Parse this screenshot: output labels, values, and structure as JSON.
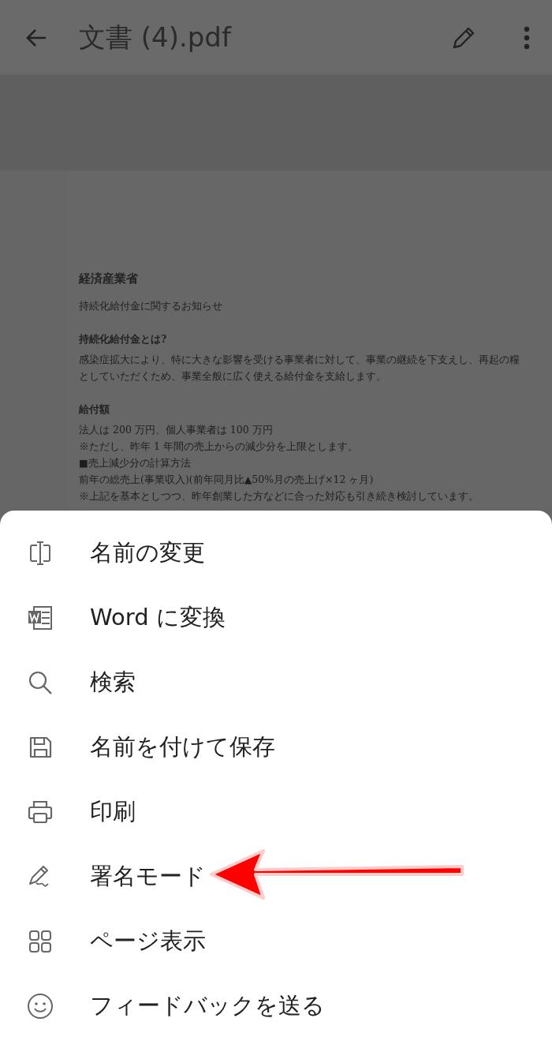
{
  "app_bar": {
    "title": "文書 (4).pdf"
  },
  "document": {
    "lines": [
      {
        "kind": "title",
        "text": "経済産業省"
      },
      {
        "kind": "text",
        "text": "持続化給付金に関するお知らせ"
      },
      {
        "kind": "heading",
        "text": "持続化給付金とは?"
      },
      {
        "kind": "text",
        "text": "感染症拡大により、特に大きな影響を受ける事業者に対して、事業の継続を下支えし、再起の糧"
      },
      {
        "kind": "text",
        "text": "としていただくため、事業全般に広く使える給付金を支給します。"
      },
      {
        "kind": "heading",
        "text": "給付額"
      },
      {
        "kind": "text",
        "text": "法人は 200 万円、個人事業者は 100 万円"
      },
      {
        "kind": "text",
        "text": "※ただし、昨年 1 年間の売上からの減少分を上限とします。"
      },
      {
        "kind": "text",
        "text": "■売上減少分の計算方法"
      },
      {
        "kind": "text",
        "text": "前年の総売上(事業収入)(前年同月比▲50%月の売上げ×12 ヶ月)"
      },
      {
        "kind": "text",
        "text": "※上記を基本としつつ、昨年創業した方などに合った対応も引き続き検討しています。"
      }
    ]
  },
  "menu": {
    "items": [
      {
        "kind": "rename",
        "label": "名前の変更"
      },
      {
        "kind": "word",
        "label": "Word に変換"
      },
      {
        "kind": "search",
        "label": "検索"
      },
      {
        "kind": "save",
        "label": "名前を付けて保存"
      },
      {
        "kind": "print",
        "label": "印刷"
      },
      {
        "kind": "sign",
        "label": "署名モード"
      },
      {
        "kind": "pages",
        "label": "ページ表示"
      },
      {
        "kind": "feedback",
        "label": "フィードバックを送る"
      }
    ]
  }
}
